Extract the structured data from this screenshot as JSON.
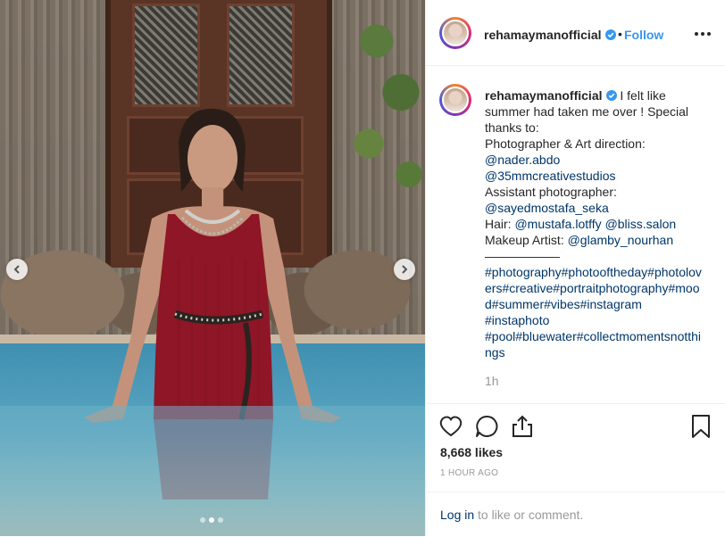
{
  "header": {
    "username": "rehamaymanofficial",
    "separator": "•",
    "follow_label": "Follow",
    "more_label": "•••"
  },
  "caption": {
    "username": "rehamaymanofficial",
    "lines": [
      "I felt like summer had taken me over ! Special thanks to:",
      "Photographer & Art direction:",
      "@nader.abdo",
      "@35mmcreativestudios",
      "Assistant photographer:",
      "@sayedmostafa_seka",
      "Hair: ",
      "@mustafa.lotffy",
      "@bliss.salon",
      "Makeup Artist: ",
      "@glamby_nourhan",
      "——————",
      "#photography#photooftheday#photolovers#creative#portraitphotography#mood#summer#vibes#instagram",
      "#instaphoto",
      "#pool#bluewater#collectmomentsnotthings"
    ],
    "time_ago": "1h"
  },
  "actions": {
    "likes": "8,668 likes",
    "post_time": "1 HOUR AGO",
    "login_link": "Log in",
    "login_rest": " to like or comment."
  },
  "carousel": {
    "dots": 3,
    "active_index": 1
  },
  "colors": {
    "link": "#003569",
    "follow": "#3897f0",
    "verified": "#3897f0",
    "muted": "#999999",
    "text": "#262626"
  },
  "icons": [
    "heart-icon",
    "comment-icon",
    "share-icon",
    "bookmark-icon",
    "chevron-left-icon",
    "chevron-right-icon",
    "verified-badge-icon",
    "more-options-icon"
  ]
}
